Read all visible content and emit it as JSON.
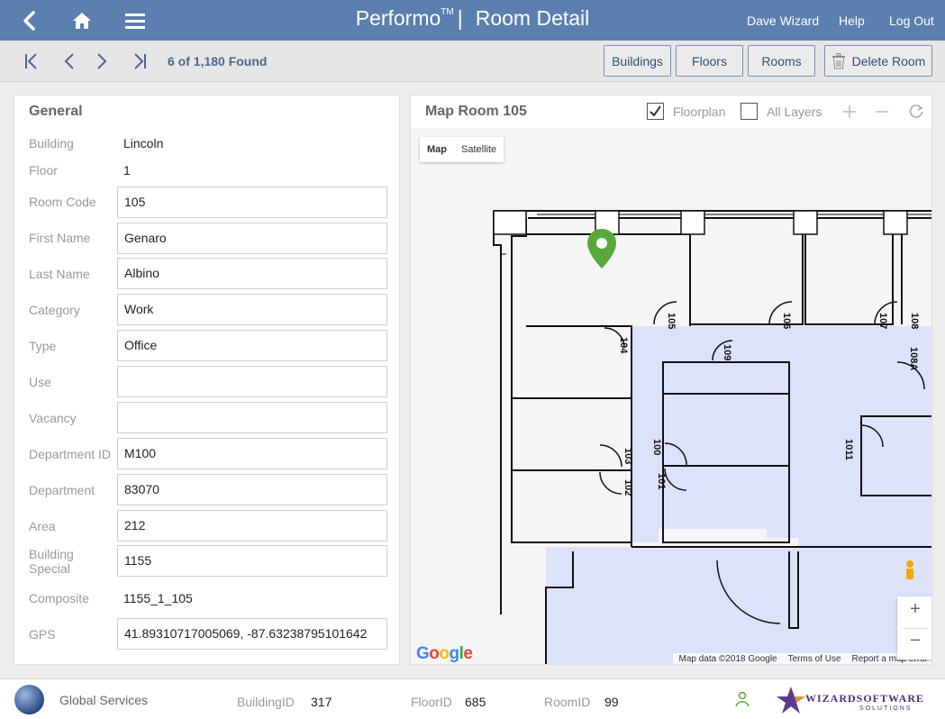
{
  "header": {
    "app_name": "Performo",
    "trademark": "TM",
    "separator": "|",
    "page_title": "Room Detail",
    "user": "Dave Wizard",
    "help": "Help",
    "logout": "Log Out"
  },
  "toolbar": {
    "record_status": "6 of 1,180 Found",
    "buttons": {
      "buildings": "Buildings",
      "floors": "Floors",
      "rooms": "Rooms",
      "delete_room": "Delete Room"
    }
  },
  "general": {
    "title": "General",
    "fields": {
      "building": {
        "label": "Building",
        "value": "Lincoln"
      },
      "floor": {
        "label": "Floor",
        "value": "1"
      },
      "room_code": {
        "label": "Room Code",
        "value": "105"
      },
      "first_name": {
        "label": "First Name",
        "value": "Genaro"
      },
      "last_name": {
        "label": "Last Name",
        "value": "Albino"
      },
      "category": {
        "label": "Category",
        "value": "Work"
      },
      "type": {
        "label": "Type",
        "value": "Office"
      },
      "use": {
        "label": "Use",
        "value": ""
      },
      "vacancy": {
        "label": "Vacancy",
        "value": ""
      },
      "department_id": {
        "label": "Department ID",
        "value": "M100"
      },
      "department": {
        "label": "Department",
        "value": "83070"
      },
      "area": {
        "label": "Area",
        "value": "212"
      },
      "building_special": {
        "label_line1": "Building",
        "label_line2": "Special",
        "value": "1155"
      },
      "composite": {
        "label": "Composite",
        "value": "1155_1_105"
      },
      "gps": {
        "label": "GPS",
        "value": "41.89310717005069, -87.63238795101642"
      }
    }
  },
  "map": {
    "title": "Map Room 105",
    "floorplan_label": "Floorplan",
    "floorplan_checked": true,
    "all_layers_label": "All Layers",
    "all_layers_checked": false,
    "map_type_map": "Map",
    "map_type_satellite": "Satellite",
    "google_logo": "Google",
    "attribution": "Map data ©2018 Google",
    "terms": "Terms of Use",
    "report": "Report a map error",
    "room_labels": [
      "105",
      "106",
      "107",
      "108",
      "104",
      "109",
      "108A",
      "103",
      "100",
      "101",
      "102",
      "1011"
    ],
    "marker_color": "#5aa83a",
    "highlight_color": "#dde2fb"
  },
  "footer": {
    "org": "Global Services",
    "building_id_label": "BuildingID",
    "building_id": "317",
    "floor_id_label": "FloorID",
    "floor_id": "685",
    "room_id_label": "RoomID",
    "room_id": "99",
    "brand": "WIZARDSOFTWARE",
    "brand_sub": "SOLUTIONS"
  },
  "colors": {
    "header_bg": "#5b7fae",
    "accent": "#4a6890"
  }
}
